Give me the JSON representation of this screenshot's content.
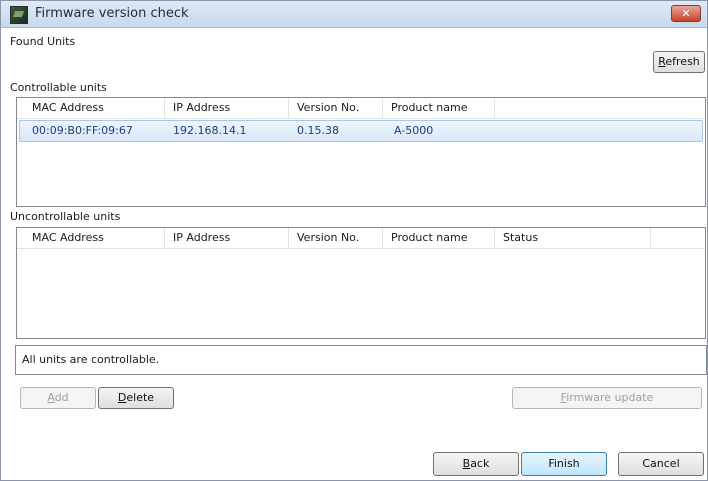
{
  "window": {
    "title": "Firmware version check",
    "close_glyph": "✕"
  },
  "found_units_label": "Found Units",
  "refresh_button": {
    "label_prefix": "",
    "mnemonic": "R",
    "label_suffix": "efresh"
  },
  "controllable": {
    "section_label": "Controllable units",
    "columns": [
      "MAC Address",
      "IP Address",
      "Version No.",
      "Product name"
    ],
    "rows": [
      {
        "mac": "00:09:B0:FF:09:67",
        "ip": "192.168.14.1",
        "version": "0.15.38",
        "product": "A-5000"
      }
    ]
  },
  "uncontrollable": {
    "section_label": "Uncontrollable units",
    "columns": [
      "MAC Address",
      "IP Address",
      "Version No.",
      "Product name",
      "Status"
    ],
    "rows": []
  },
  "status_message": "All units are controllable.",
  "buttons": {
    "add": {
      "mnemonic": "A",
      "rest": "dd"
    },
    "delete": {
      "mnemonic": "D",
      "rest": "elete"
    },
    "firmware_update": {
      "mnemonic": "F",
      "rest": "irmware update"
    },
    "back": {
      "mnemonic": "B",
      "rest": "ack"
    },
    "finish": "Finish",
    "cancel": "Cancel"
  },
  "colors": {
    "selection_text": "#1e3e7b",
    "close_red": "#c7432c"
  }
}
